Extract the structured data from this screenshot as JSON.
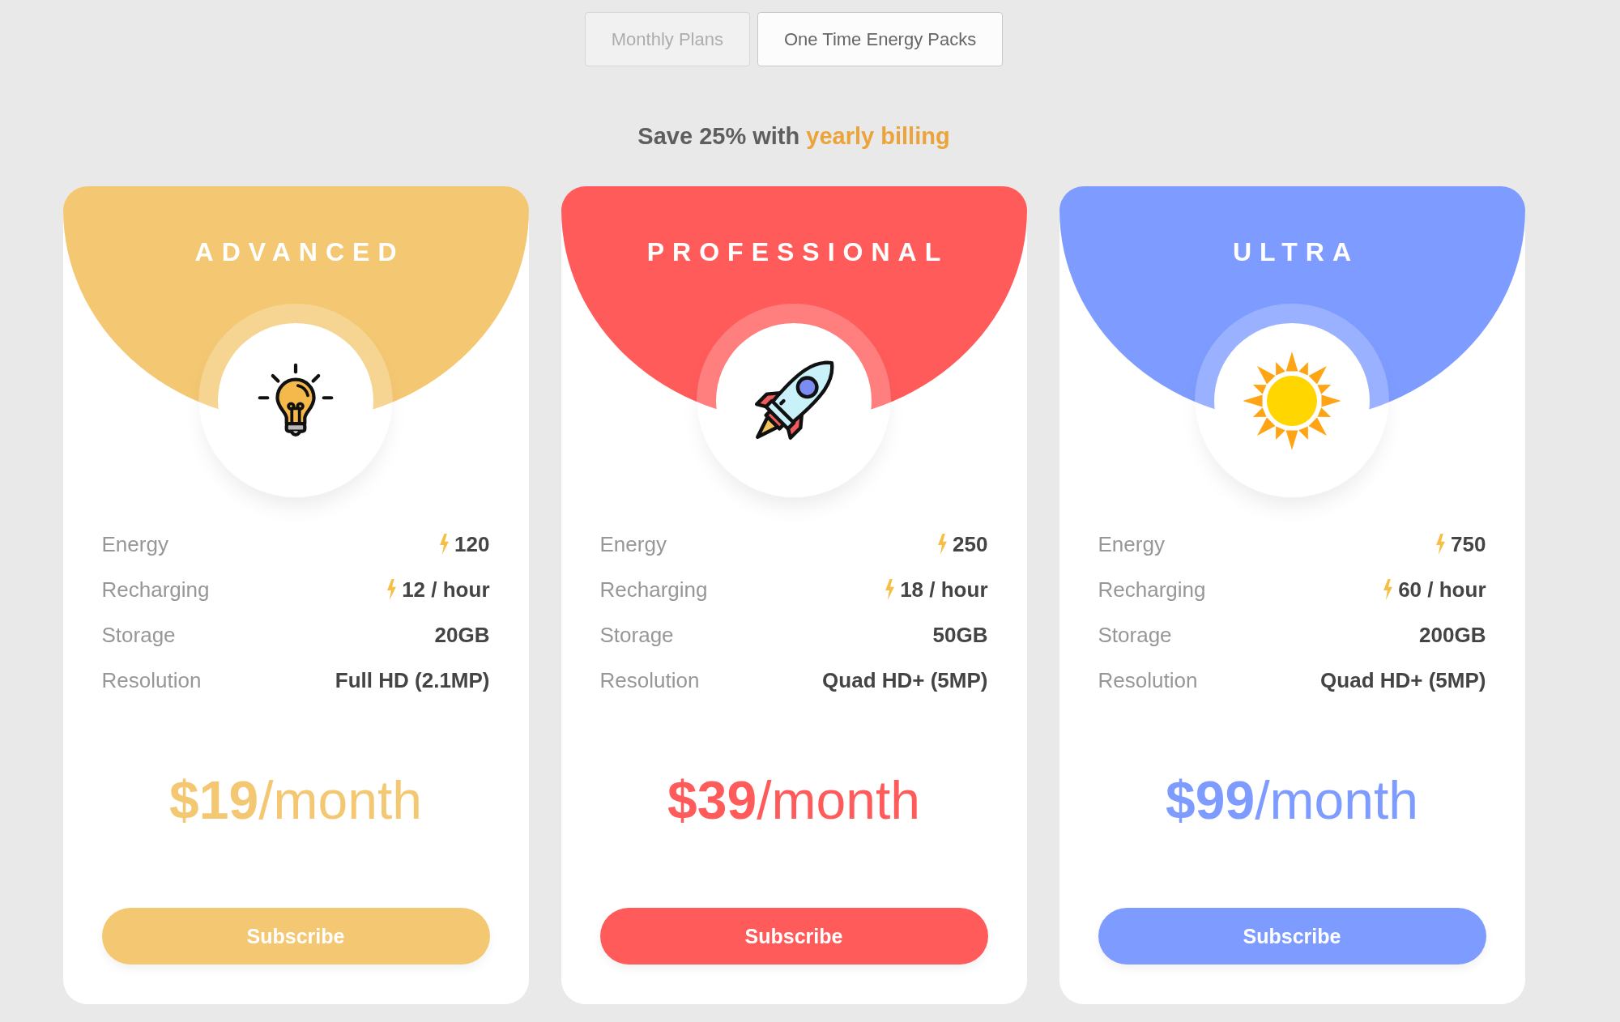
{
  "tabs": [
    {
      "label": "Monthly Plans",
      "selected": false
    },
    {
      "label": "One Time Energy Packs",
      "selected": true
    }
  ],
  "promo": {
    "text": "Save 25% with",
    "link": "yearly billing"
  },
  "plans": [
    {
      "name": "ADVANCED",
      "color": "#f4c872",
      "features": [
        {
          "kind": "bolt",
          "label": "Energy",
          "value": "120"
        },
        {
          "kind": "bolt",
          "label": "Recharging",
          "value": "12 / hour"
        },
        {
          "kind": "plain",
          "label": "Storage",
          "value": "20GB"
        },
        {
          "kind": "plain",
          "label": "Resolution",
          "value": "Full HD (2.1MP)"
        }
      ],
      "price": "**$19**/month",
      "button": "Subscribe"
    },
    {
      "name": "PROFESSIONAL",
      "color": "#ff5b5b",
      "features": [
        {
          "kind": "bolt",
          "label": "Energy",
          "value": "250"
        },
        {
          "kind": "bolt",
          "label": "Recharging",
          "value": "18 / hour"
        },
        {
          "kind": "plain",
          "label": "Storage",
          "value": "50GB"
        },
        {
          "kind": "plain",
          "label": "Resolution",
          "value": "Quad HD+ (5MP)"
        }
      ],
      "price": "**$39**/month",
      "button": "Subscribe"
    },
    {
      "name": "ULTRA",
      "color": "#7e9cff",
      "features": [
        {
          "kind": "bolt",
          "label": "Energy",
          "value": "750"
        },
        {
          "kind": "bolt",
          "label": "Recharging",
          "value": "60 / hour"
        },
        {
          "kind": "plain",
          "label": "Storage",
          "value": "200GB"
        },
        {
          "kind": "plain",
          "label": "Resolution",
          "value": "Quad HD+ (5MP)"
        }
      ],
      "price": "**$99**/month",
      "button": "Subscribe"
    }
  ]
}
